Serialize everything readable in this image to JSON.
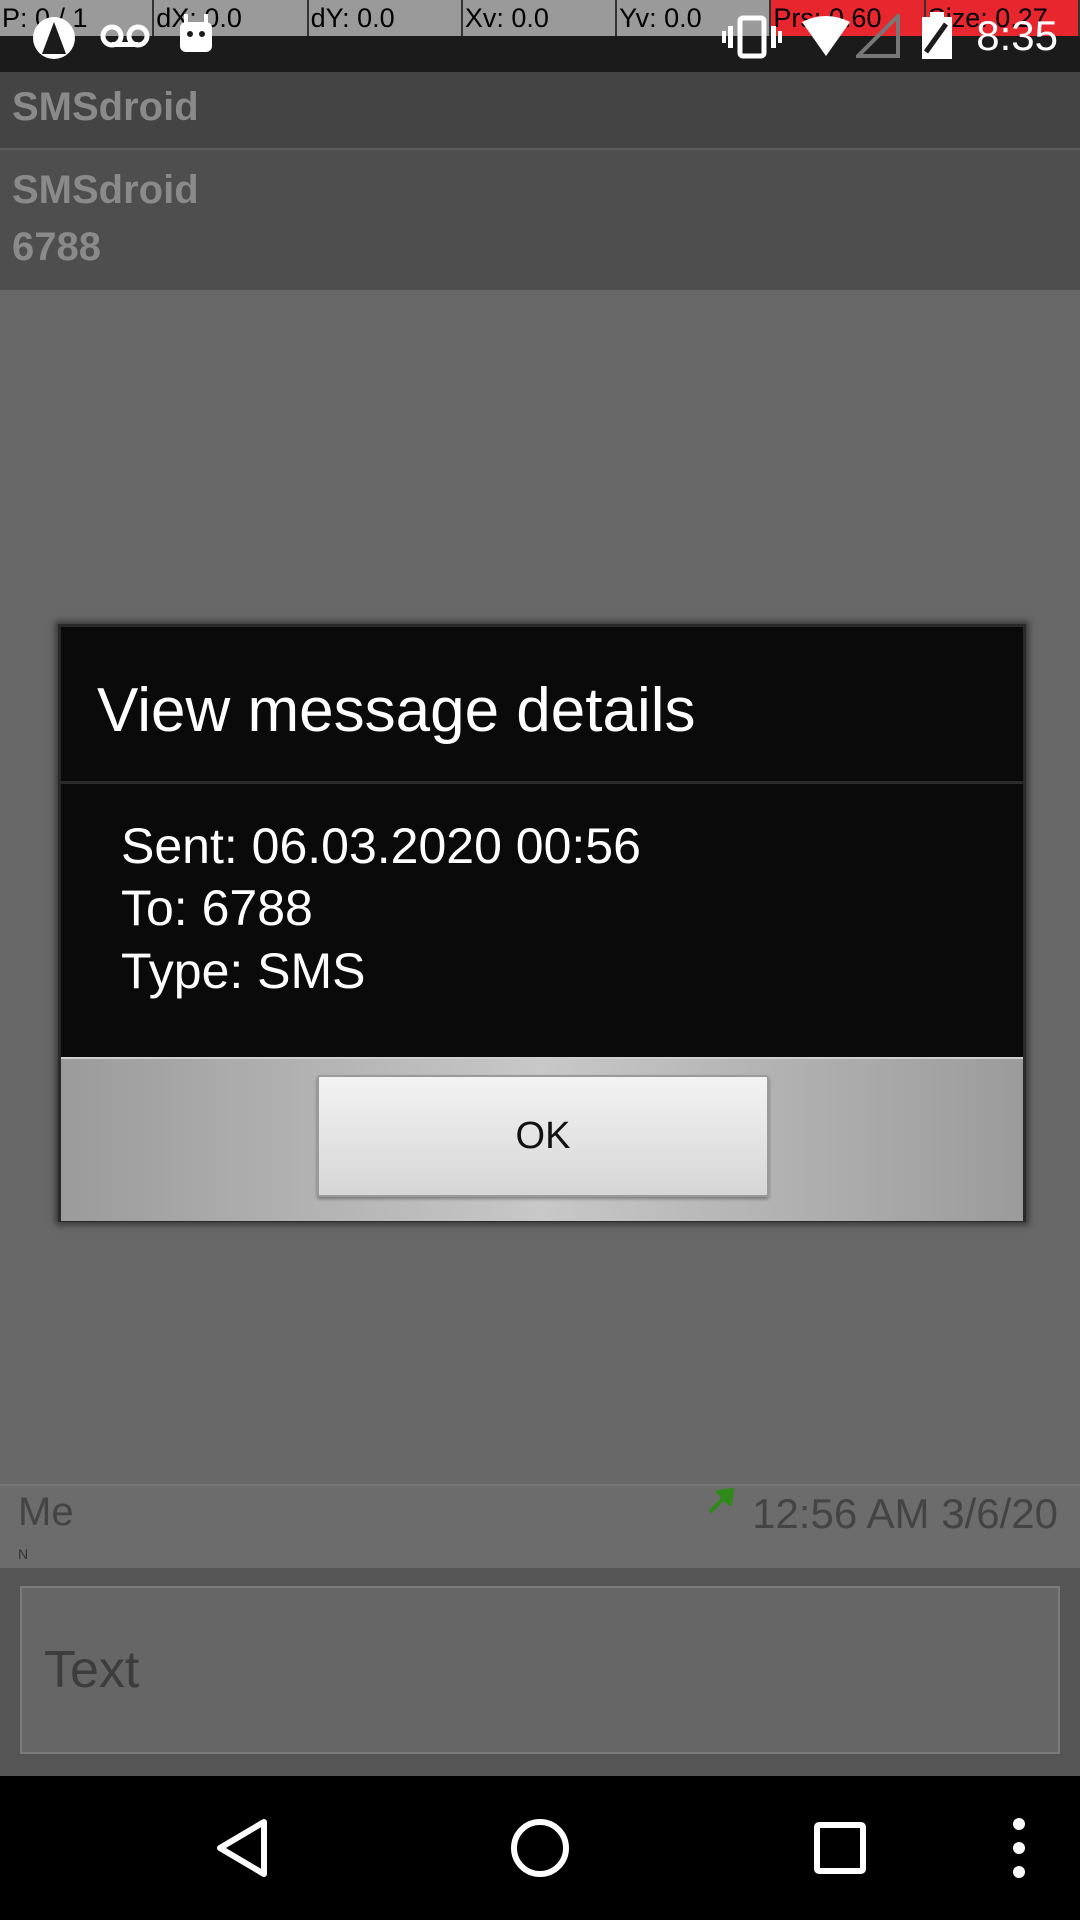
{
  "status_bar": {
    "pointer_overlay": [
      {
        "text": "P: 0 / 1",
        "highlight": false
      },
      {
        "text": "dX: 0.0",
        "highlight": false
      },
      {
        "text": "dY: 0.0",
        "highlight": false
      },
      {
        "text": "Xv: 0.0",
        "highlight": false
      },
      {
        "text": "Yv: 0.0",
        "highlight": false
      },
      {
        "text": "Prs: 0.60",
        "highlight": true
      },
      {
        "text": "Size: 0.27",
        "highlight": true
      }
    ],
    "time": "8:35",
    "icons": [
      "app-notification-icon",
      "voicemail-icon",
      "android-icon",
      "vibrate-icon",
      "wifi-icon",
      "signal-icon",
      "battery-icon"
    ]
  },
  "app": {
    "title": "SMSdroid"
  },
  "conversation": {
    "name": "SMSdroid",
    "number": "6788"
  },
  "message": {
    "sender": "Me",
    "flag": "N",
    "time": "12:56 AM 3/6/20",
    "status_icon": "sent-arrow-icon"
  },
  "compose": {
    "placeholder": "Text"
  },
  "dialog": {
    "title": "View message details",
    "sent": "Sent: 06.03.2020 00:56",
    "to": "To: 6788",
    "type": "Type: SMS",
    "ok_label": "OK"
  },
  "nav_bar": {
    "icons": [
      "back-icon",
      "home-icon",
      "recents-icon",
      "overflow-menu-icon"
    ]
  },
  "colors": {
    "dialog_background": "#0a0a0a",
    "overlay_highlight": "#e8262e",
    "sent_icon": "#2f8a1a"
  }
}
